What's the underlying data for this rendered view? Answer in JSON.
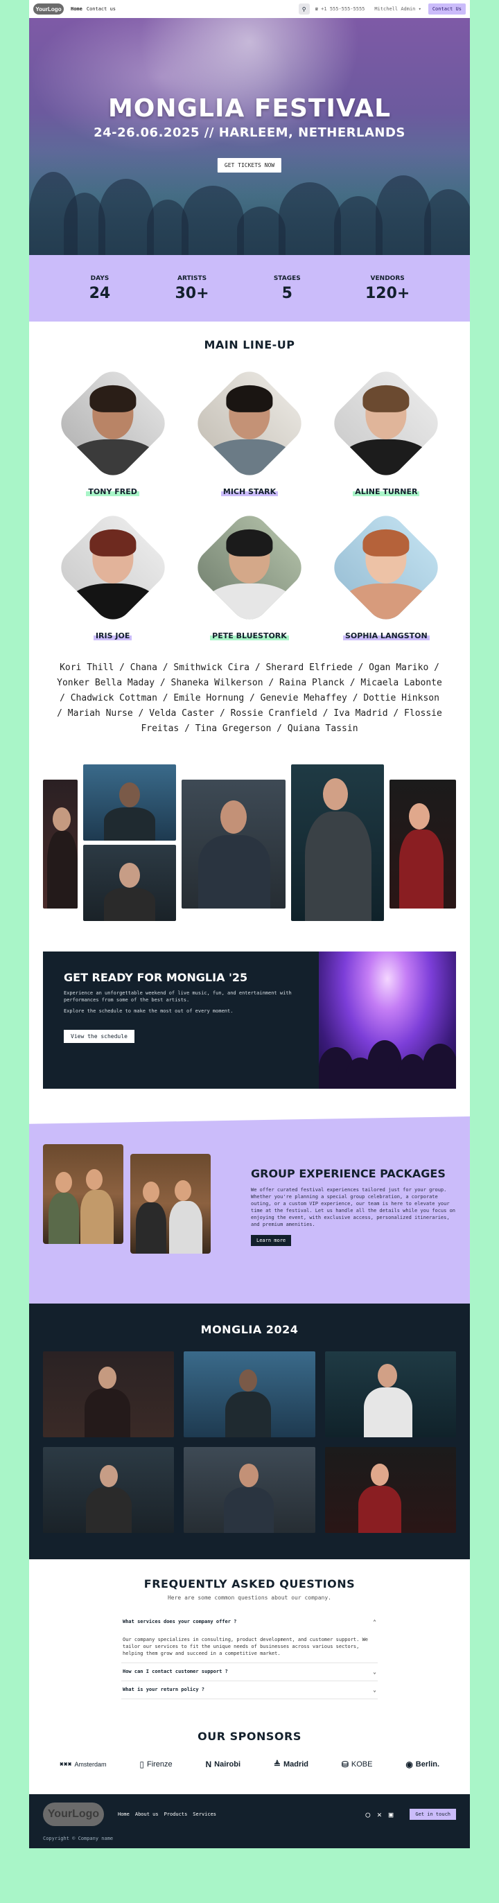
{
  "nav": {
    "logo": "YourLogo",
    "links": [
      "Home",
      "Contact us"
    ],
    "phone": "+1 555-555-5555",
    "user": "Mitchell Admin",
    "contact_button": "Contact Us"
  },
  "hero": {
    "title": "MONGLIA FESTIVAL",
    "subtitle": "24-26.06.2025 // HARLEEM, NETHERLANDS",
    "cta": "GET TICKETS NOW"
  },
  "stats": [
    {
      "label": "DAYS",
      "value": "24"
    },
    {
      "label": "ARTISTS",
      "value": "30+"
    },
    {
      "label": "STAGES",
      "value": "5"
    },
    {
      "label": "VENDORS",
      "value": "120+"
    }
  ],
  "lineup": {
    "title": "MAIN LINE-UP",
    "artists": [
      {
        "name": "TONY FRED",
        "highlight": "#a9f5c8"
      },
      {
        "name": "MICH STARK",
        "highlight": "#cbbcfa"
      },
      {
        "name": "ALINE TURNER",
        "highlight": "#a9f5c8"
      },
      {
        "name": "IRIS JOE",
        "highlight": "#cbbcfa"
      },
      {
        "name": "PETE BLUESTORK",
        "highlight": "#a9f5c8"
      },
      {
        "name": "SOPHIA LANGSTON",
        "highlight": "#cbbcfa"
      }
    ],
    "others": "Kori Thill / Chana / Smithwick Cira / Sherard Elfriede / Ogan Mariko / Yonker Bella Maday / Shaneka Wilkerson / Raina Planck / Micaela Labonte / Chadwick Cottman / Emile Hornung / Genevie Mehaffey / Dottie Hinkson / Mariah Nurse / Velda Caster / Rossie Cranfield / Iva Madrid / Flossie Freitas / Tina Gregerson / Quiana Tassin"
  },
  "ready": {
    "title": "GET READY FOR MONGLIA '25",
    "p1": "Experience an unforgettable weekend of live music, fun, and entertainment with performances from some of the best artists.",
    "p2": "Explore the schedule to make the most out of every moment.",
    "button": "View the schedule"
  },
  "group": {
    "title": "GROUP EXPERIENCE PACKAGES",
    "text": "We offer curated festival experiences tailored just for your group. Whether you're planning a special group celebration, a corporate outing, or a custom VIP experience, our team is here to elevate your time at the festival. Let us handle all the details while you focus on enjoying the event, with exclusive access, personalized itineraries, and premium amenities.",
    "button": "Learn more"
  },
  "gallery": {
    "title": "MONGLIA 2024"
  },
  "faq": {
    "title": "FREQUENTLY ASKED QUESTIONS",
    "subtitle": "Here are some common questions about our company.",
    "items": [
      {
        "q": "What services does your company offer ?",
        "a": "Our company specializes in consulting, product development, and customer support. We tailor our services to fit the unique needs of businesses across various sectors, helping them grow and succeed in a competitive market.",
        "open": true
      },
      {
        "q": "How can I contact customer support ?",
        "a": "",
        "open": false
      },
      {
        "q": "What is your return policy ?",
        "a": "",
        "open": false
      }
    ]
  },
  "sponsors": {
    "title": "OUR SPONSORS",
    "items": [
      {
        "name": "Amsterdam",
        "icon": "xxx-icon"
      },
      {
        "name": "Firenze",
        "icon": "pillars-icon"
      },
      {
        "name": "Nairobi",
        "icon": "n-logo-icon"
      },
      {
        "name": "Madrid",
        "icon": "m-logo-icon"
      },
      {
        "name": "KOBE",
        "icon": "kobe-icon"
      },
      {
        "name": "Berlin.",
        "icon": "bear-icon"
      }
    ]
  },
  "footer": {
    "logo": "YourLogo",
    "links": [
      "Home",
      "About us",
      "Products",
      "Services"
    ],
    "cta": "Get in touch",
    "copyright": "Copyright © Company name"
  },
  "colors": {
    "green": "#a9f5c8",
    "purple": "#cbbcfa",
    "navy": "#13202c"
  }
}
